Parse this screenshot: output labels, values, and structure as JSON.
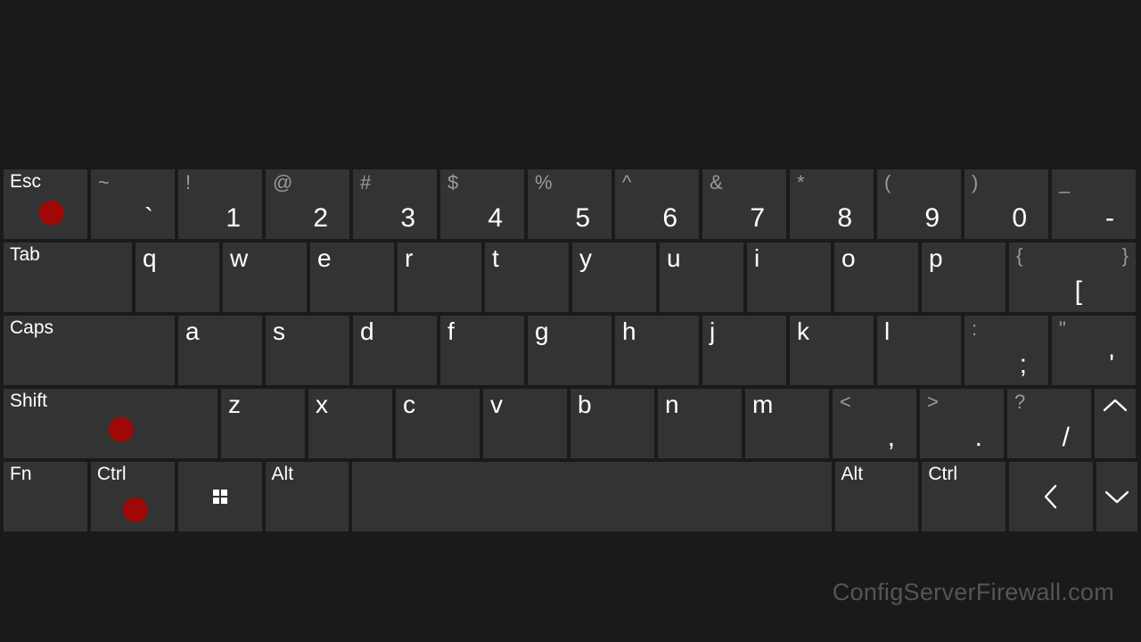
{
  "rows": {
    "r1": {
      "esc": "Esc",
      "keys": [
        {
          "up": "~",
          "low": "`"
        },
        {
          "up": "!",
          "low": "1"
        },
        {
          "up": "@",
          "low": "2"
        },
        {
          "up": "#",
          "low": "3"
        },
        {
          "up": "$",
          "low": "4"
        },
        {
          "up": "%",
          "low": "5"
        },
        {
          "up": "^",
          "low": "6"
        },
        {
          "up": "&",
          "low": "7"
        },
        {
          "up": "*",
          "low": "8"
        },
        {
          "up": "(",
          "low": "9"
        },
        {
          "up": ")",
          "low": "0"
        },
        {
          "up": "_",
          "low": "-"
        }
      ]
    },
    "r2": {
      "tab": "Tab",
      "keys": [
        "q",
        "w",
        "e",
        "r",
        "t",
        "y",
        "u",
        "i",
        "o",
        "p"
      ],
      "brackets": {
        "up": "{",
        "low": "[",
        "up2": "}"
      }
    },
    "r3": {
      "caps": "Caps",
      "keys": [
        "a",
        "s",
        "d",
        "f",
        "g",
        "h",
        "j",
        "k",
        "l"
      ],
      "semi": {
        "up": ":",
        "low": ";"
      },
      "quote": {
        "up": "\"",
        "low": "'"
      }
    },
    "r4": {
      "shift": "Shift",
      "keys": [
        "z",
        "x",
        "c",
        "v",
        "b",
        "n",
        "m"
      ],
      "comma": {
        "up": "<",
        "low": ","
      },
      "period": {
        "up": ">",
        "low": "."
      },
      "slash": {
        "up": "?",
        "low": "/"
      }
    },
    "r5": {
      "fn": "Fn",
      "ctrlL": "Ctrl",
      "altL": "Alt",
      "altR": "Alt",
      "ctrlR": "Ctrl"
    }
  },
  "watermark": "ConfigServerFirewall.com",
  "indicator_color": "#a00808"
}
